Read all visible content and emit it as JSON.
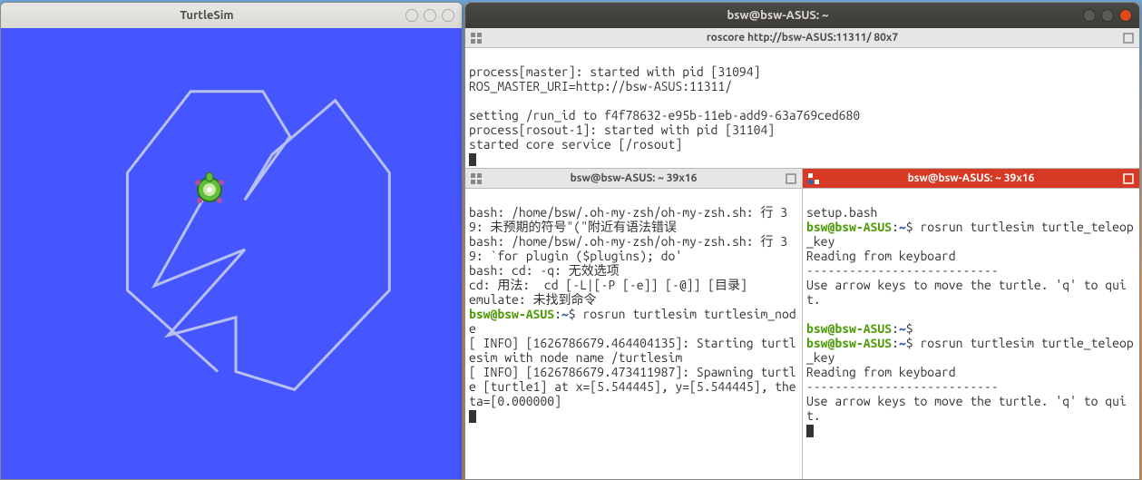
{
  "turtlesim": {
    "title": "TurtleSim"
  },
  "terminal": {
    "title": "bsw@bsw-ASUS: ~",
    "top_pane": {
      "tab": "roscore http://bsw-ASUS:11311/ 80x7",
      "lines": {
        "l1": "process[master]: started with pid [31094]",
        "l2": "ROS_MASTER_URI=http://bsw-ASUS:11311/",
        "l3": "",
        "l4": "setting /run_id to f4f78632-e95b-11eb-add9-63a769ced680",
        "l5": "process[rosout-1]: started with pid [31104]",
        "l6": "started core service [/rosout]"
      }
    },
    "bl_pane": {
      "tab": "bsw@bsw-ASUS: ~ 39x16",
      "l1": "bash: /home/bsw/.oh-my-zsh/oh-my-zsh.sh: 行 39: 未预期的符号\"(\"附近有语法错误",
      "l2": "bash: /home/bsw/.oh-my-zsh/oh-my-zsh.sh: 行 39: `for plugin ($plugins); do'",
      "l3": "bash: cd: -q: 无效选项",
      "l4": "cd: 用法:  cd [-L|[-P [-e]] [-@]] [目录]",
      "l5": "emulate: 未找到命令",
      "prompt_user": "bsw@bsw-ASUS",
      "prompt_sep": ":",
      "prompt_path": "~",
      "prompt_dollar": "$ ",
      "cmd1": "rosrun turtlesim turtlesim_node",
      "l6": "[ INFO] [1626786679.464404135]: Starting turtlesim with node name /turtlesim",
      "l7": "[ INFO] [1626786679.473411987]: Spawning turtle [turtle1] at x=[5.544445], y=[5.544445], theta=[0.000000]"
    },
    "br_pane": {
      "tab": "bsw@bsw-ASUS: ~ 39x16",
      "l1": "setup.bash",
      "prompt_user": "bsw@bsw-ASUS",
      "prompt_sep": ":",
      "prompt_path": "~",
      "prompt_dollar": "$ ",
      "cmd1": "rosrun turtlesim turtle_teleop_key",
      "l2": "Reading from keyboard",
      "l3": "---------------------------",
      "l4": "Use arrow keys to move the turtle. 'q' to quit.",
      "cmd2": "",
      "cmd3": "rosrun turtlesim turtle_teleop_key",
      "l5": "Reading from keyboard",
      "l6": "---------------------------",
      "l7": "Use arrow keys to move the turtle. 'q' to quit."
    }
  }
}
